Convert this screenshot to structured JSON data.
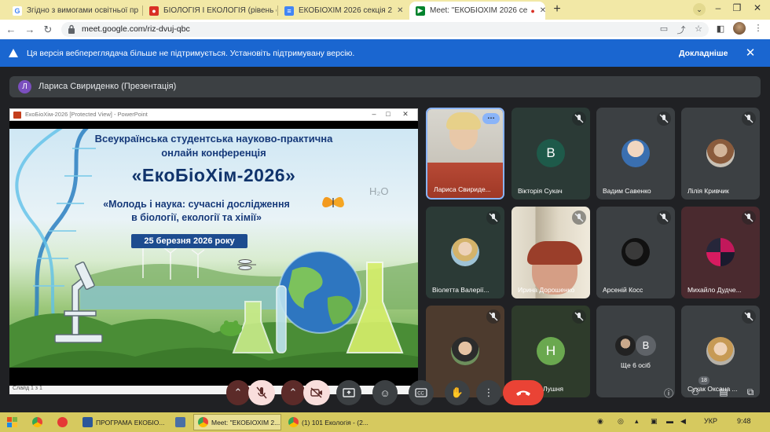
{
  "browser": {
    "tabs": [
      {
        "title": "Згідно з вимогами освітньої пр",
        "favicon": "google-icon",
        "active": false
      },
      {
        "title": "БІОЛОГІЯ І ЕКОЛОГІЯ (рівень ст",
        "favicon": "pdf-icon",
        "active": false
      },
      {
        "title": "ЕКОБІОХІМ 2026 секція 2",
        "favicon": "docs-icon",
        "active": false
      },
      {
        "title": "Meet: \"ЕКОБІОХІМ 2026 се",
        "favicon": "meet-icon",
        "active": true
      }
    ],
    "new_tab_label": "+",
    "url": "meet.google.com/riz-dvuj-qbc"
  },
  "infobar": {
    "message": "Ця версія веб­переглядача більше не підтримується. Установіть підтримувану версію.",
    "details_label": "Докладніше",
    "close_label": "✕"
  },
  "meet": {
    "presenter_initial": "Л",
    "presenter_label": "Лариса Свириденко (Презентація)",
    "ppt_window_title": "ЕкоБіоХім-2026 [Protected View] - PowerPoint",
    "ppt_status": "Слайд 1 з 1",
    "slide": {
      "line1": "Всеукраїнська студентська науково-практична",
      "line2": "онлайн конференція",
      "title": "«ЕкоБіоХім-2026»",
      "subtitle1": "«Молодь і наука: сучасні дослідження",
      "subtitle2": "в біології, екології та хімії»",
      "date": "25 березня 2026 року",
      "formula": "H₂O"
    },
    "participants": [
      {
        "name": "Лариса Свириде...",
        "type": "video",
        "speaking": true
      },
      {
        "name": "Вікторія Сукач",
        "type": "letter",
        "letter": "В",
        "color": "#1e5a4a",
        "muted": true
      },
      {
        "name": "Вадим Савенко",
        "type": "photo",
        "muted": true
      },
      {
        "name": "Лілія Кривчик",
        "type": "photo",
        "muted": true
      },
      {
        "name": "Віолетта Валерії...",
        "type": "photo",
        "muted": true
      },
      {
        "name": "Ирина Дорошенко",
        "type": "video",
        "muted": true
      },
      {
        "name": "Арсеній Косс",
        "type": "photo",
        "muted": true
      },
      {
        "name": "Михайло Дудче...",
        "type": "photo",
        "muted": true
      },
      {
        "name": "",
        "type": "photo",
        "muted": true
      },
      {
        "name": "Лушня",
        "type": "letter",
        "letter": "Н",
        "color": "#6aa84f",
        "muted": true
      },
      {
        "name": "Ще 6 осіб",
        "type": "group",
        "letter": "В"
      },
      {
        "name": "Сухак Оксана ...",
        "type": "photo",
        "muted": true
      }
    ],
    "people_count": "18"
  },
  "taskbar": {
    "items": [
      {
        "label": "ПРОГРАМА ЕКОБІО...",
        "icon": "word-icon"
      },
      {
        "label": "Meet: \"ЕКОБІОХІМ 2...",
        "icon": "chrome-icon"
      },
      {
        "label": "(1) 101 Екологія - (2...",
        "icon": "chrome-icon"
      }
    ],
    "lang": "УКР",
    "time": "9:48"
  }
}
